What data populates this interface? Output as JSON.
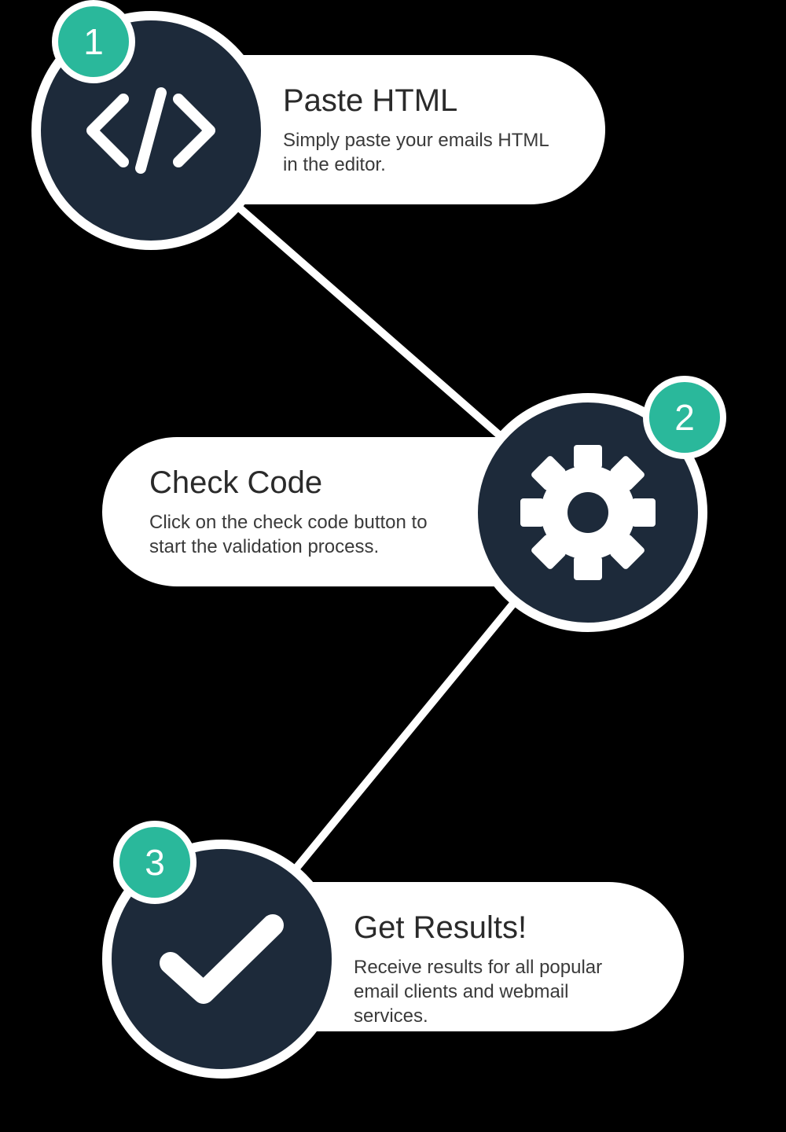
{
  "colors": {
    "accent": "#2ab89b",
    "circle_fill": "#1d2a3a",
    "icon_fill": "#ffffff",
    "text": "#2a2a2a"
  },
  "steps": [
    {
      "number": "1",
      "title": "Paste HTML",
      "description": "Simply paste your emails HTML in the editor.",
      "icon": "code-icon"
    },
    {
      "number": "2",
      "title": "Check Code",
      "description": "Click on the check code button to start the validation process.",
      "icon": "gear-icon"
    },
    {
      "number": "3",
      "title": "Get Results!",
      "description": "Receive results for all popular email clients and webmail services.",
      "icon": "check-icon"
    }
  ]
}
